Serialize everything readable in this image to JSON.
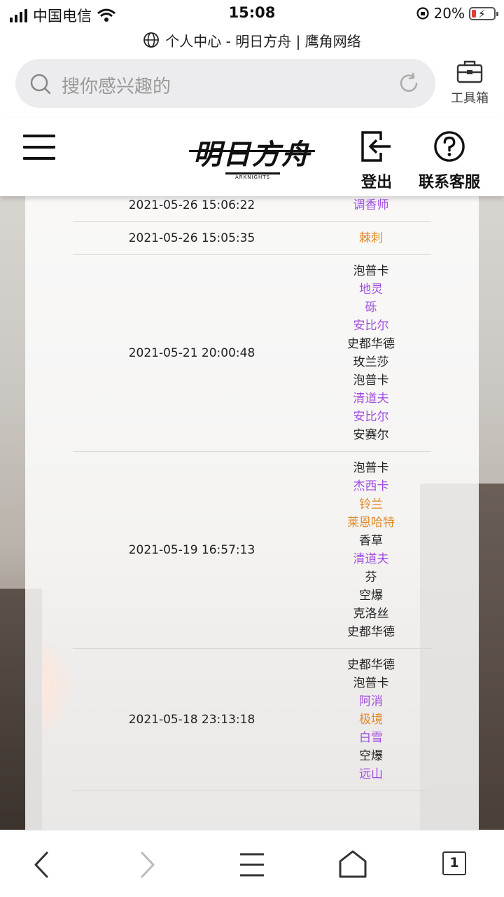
{
  "status_bar": {
    "carrier": "中国电信",
    "time": "15:08",
    "battery_percent": "20%",
    "battery_level": 0.2
  },
  "browser": {
    "page_title": "个人中心 - 明日方舟 | 鹰角网络",
    "search_placeholder": "搜你感兴趣的",
    "toolbox_label": "工具箱",
    "tab_count": "1"
  },
  "site_header": {
    "logo_text": "明日方舟",
    "logo_subtext": "ARKNIGHTS",
    "logout_label": "登出",
    "contact_label": "联系客服"
  },
  "colors": {
    "rarity_3": "#222222",
    "rarity_4": "#a04de0",
    "rarity_5": "#e08a2a"
  },
  "records": [
    {
      "time": "2021-05-26 15:06:22",
      "operators": [
        {
          "name": "调香师",
          "rarity": 4
        }
      ]
    },
    {
      "time": "2021-05-26 15:05:35",
      "operators": [
        {
          "name": "棘刺",
          "rarity": 5
        }
      ]
    },
    {
      "time": "2021-05-21 20:00:48",
      "operators": [
        {
          "name": "泡普卡",
          "rarity": 3
        },
        {
          "name": "地灵",
          "rarity": 4
        },
        {
          "name": "砾",
          "rarity": 4
        },
        {
          "name": "安比尔",
          "rarity": 4
        },
        {
          "name": "史都华德",
          "rarity": 3
        },
        {
          "name": "玫兰莎",
          "rarity": 3
        },
        {
          "name": "泡普卡",
          "rarity": 3
        },
        {
          "name": "清道夫",
          "rarity": 4
        },
        {
          "name": "安比尔",
          "rarity": 4
        },
        {
          "name": "安赛尔",
          "rarity": 3
        }
      ]
    },
    {
      "time": "2021-05-19 16:57:13",
      "operators": [
        {
          "name": "泡普卡",
          "rarity": 3
        },
        {
          "name": "杰西卡",
          "rarity": 4
        },
        {
          "name": "铃兰",
          "rarity": 5
        },
        {
          "name": "莱恩哈特",
          "rarity": 5
        },
        {
          "name": "香草",
          "rarity": 3
        },
        {
          "name": "清道夫",
          "rarity": 4
        },
        {
          "name": "芬",
          "rarity": 3
        },
        {
          "name": "空爆",
          "rarity": 3
        },
        {
          "name": "克洛丝",
          "rarity": 3
        },
        {
          "name": "史都华德",
          "rarity": 3
        }
      ]
    },
    {
      "time": "2021-05-18 23:13:18",
      "operators": [
        {
          "name": "史都华德",
          "rarity": 3
        },
        {
          "name": "泡普卡",
          "rarity": 3
        },
        {
          "name": "阿消",
          "rarity": 4
        },
        {
          "name": "极境",
          "rarity": 5
        },
        {
          "name": "白雪",
          "rarity": 4
        },
        {
          "name": "空爆",
          "rarity": 3
        },
        {
          "name": "远山",
          "rarity": 4
        }
      ]
    }
  ]
}
